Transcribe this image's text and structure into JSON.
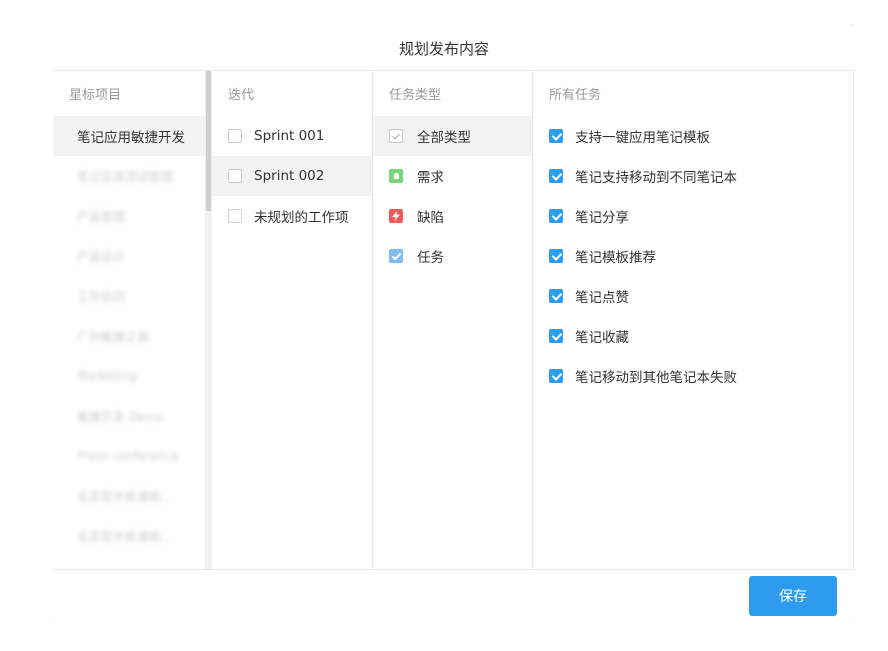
{
  "dialog": {
    "title": "规划发布内容"
  },
  "starred": {
    "header": "星标项目",
    "items": [
      {
        "label": "笔记应用敏捷开发",
        "selected": true,
        "blurred": false
      },
      {
        "label": "笔记应用测试管理",
        "selected": false,
        "blurred": true
      },
      {
        "label": "产品管理",
        "selected": false,
        "blurred": true
      },
      {
        "label": "产品设计",
        "selected": false,
        "blurred": true
      },
      {
        "label": "工作协同",
        "selected": false,
        "blurred": true
      },
      {
        "label": "广州敏捷之旅",
        "selected": false,
        "blurred": true
      },
      {
        "label": "Marketing",
        "selected": false,
        "blurred": true
      },
      {
        "label": "敏捷开发 Demo",
        "selected": false,
        "blurred": true
      },
      {
        "label": "Press conference",
        "selected": false,
        "blurred": true
      },
      {
        "label": "北京软件新潮新...",
        "selected": false,
        "blurred": true
      },
      {
        "label": "北京软件新潮新...",
        "selected": false,
        "blurred": true
      }
    ]
  },
  "iterations": {
    "header": "迭代",
    "items": [
      {
        "label": "Sprint 001",
        "checked": false,
        "selected": false
      },
      {
        "label": "Sprint 002",
        "checked": false,
        "selected": true
      },
      {
        "label": "未规划的工作项",
        "checked": false,
        "selected": false
      }
    ]
  },
  "task_types": {
    "header": "任务类型",
    "items": [
      {
        "label": "全部类型",
        "icon": "check-all-icon",
        "selected": true
      },
      {
        "label": "需求",
        "icon": "lightbulb-icon",
        "color": "#7bd67d",
        "selected": false
      },
      {
        "label": "缺陷",
        "icon": "lightning-icon",
        "color": "#f05a5a",
        "selected": false
      },
      {
        "label": "任务",
        "icon": "task-check-icon",
        "color": "#7fbdf0",
        "selected": false
      }
    ]
  },
  "tasks": {
    "header": "所有任务",
    "items": [
      {
        "label": "支持一键应用笔记模板",
        "checked": true
      },
      {
        "label": "笔记支持移动到不同笔记本",
        "checked": true
      },
      {
        "label": "笔记分享",
        "checked": true
      },
      {
        "label": "笔记模板推荐",
        "checked": true
      },
      {
        "label": "笔记点赞",
        "checked": true
      },
      {
        "label": "笔记收藏",
        "checked": true
      },
      {
        "label": "笔记移动到其他笔记本失败",
        "checked": true
      }
    ]
  },
  "footer": {
    "save_label": "保存"
  },
  "colors": {
    "accent": "#2d9cef",
    "checkbox": "#2f9bf0",
    "selected_row": "#f3f3f3"
  }
}
